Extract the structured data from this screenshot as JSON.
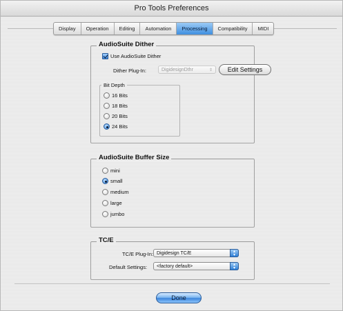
{
  "window": {
    "title": "Pro Tools Preferences"
  },
  "tabs": [
    {
      "label": "Display",
      "active": false
    },
    {
      "label": "Operation",
      "active": false
    },
    {
      "label": "Editing",
      "active": false
    },
    {
      "label": "Automation",
      "active": false
    },
    {
      "label": "Processing",
      "active": true
    },
    {
      "label": "Compatibility",
      "active": false
    },
    {
      "label": "MIDI",
      "active": false
    }
  ],
  "dither": {
    "title": "AudioSuite Dither",
    "use_checkbox_label": "Use AudioSuite Dither",
    "use_checked": true,
    "plugin_label": "Dither Plug-In:",
    "plugin_value": "DigidesignDthr",
    "edit_settings_label": "Edit Settings",
    "bit_depth_title": "Bit Depth",
    "bit_depth_options": [
      "16 Bits",
      "18 Bits",
      "20 Bits",
      "24 Bits"
    ],
    "bit_depth_selected": "24 Bits"
  },
  "buffer": {
    "title": "AudioSuite Buffer Size",
    "options": [
      "mini",
      "small",
      "medium",
      "large",
      "jumbo"
    ],
    "selected": "small"
  },
  "tce": {
    "title": "TC/E",
    "plugin_label": "TC/E Plug-In:",
    "plugin_value": "Digidesign TC/E",
    "default_label": "Default Settings:",
    "default_value": "<factory default>"
  },
  "footer": {
    "done_label": "Done"
  },
  "colors": {
    "accent": "#3d86dc",
    "background": "#ececec"
  }
}
